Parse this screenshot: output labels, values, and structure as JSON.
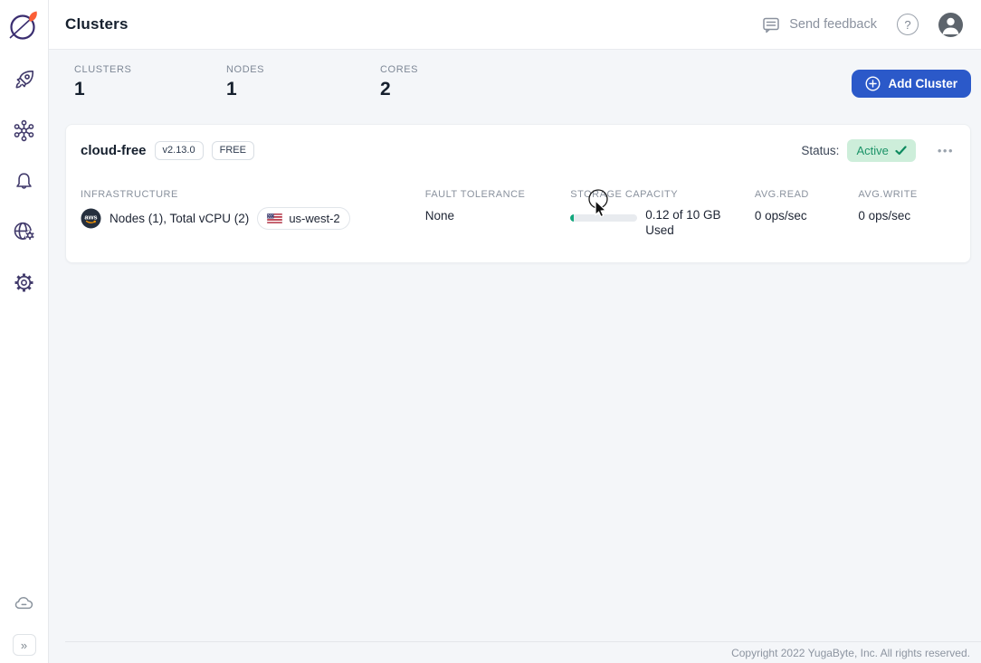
{
  "colors": {
    "accent_blue": "#2b59c9",
    "status_green_bg": "#cdeeda",
    "status_green_text": "#1a9367",
    "brand_orange": "#fb5e36",
    "sidebar_icon": "#413a6b",
    "progress_fill": "#12a77c"
  },
  "sidebar": {
    "icons": [
      "yugabyte-logo",
      "rocket",
      "cluster-network",
      "bell",
      "globe-gear",
      "gear",
      "cloud",
      "expand-chevrons"
    ],
    "expand_glyph": "»"
  },
  "header": {
    "title": "Clusters",
    "send_feedback_label": "Send feedback",
    "help_glyph": "?"
  },
  "stats": {
    "items": [
      {
        "label": "CLUSTERS",
        "value": "1"
      },
      {
        "label": "NODES",
        "value": "1"
      },
      {
        "label": "CORES",
        "value": "2"
      }
    ],
    "add_cluster_label": "Add Cluster"
  },
  "cluster_card": {
    "name": "cloud-free",
    "version_badge": "v2.13.0",
    "tier_badge": "FREE",
    "status_label": "Status:",
    "status_value": "Active",
    "menu_glyph": "•••",
    "infrastructure": {
      "label": "INFRASTRUCTURE",
      "provider": "aws",
      "summary": "Nodes (1), Total vCPU (2)",
      "region": "us-west-2"
    },
    "fault_tolerance": {
      "label": "FAULT TOLERANCE",
      "value": "None"
    },
    "storage": {
      "label": "STORAGE CAPACITY",
      "used_line1": "0.12 of 10 GB",
      "used_line2": "Used",
      "percent_used": 1.2
    },
    "avg_read": {
      "label": "AVG.READ",
      "value": "0 ops/sec"
    },
    "avg_write": {
      "label": "AVG.WRITE",
      "value": "0 ops/sec"
    }
  },
  "footer": {
    "copyright": "Copyright 2022 YugaByte, Inc. All rights reserved."
  }
}
